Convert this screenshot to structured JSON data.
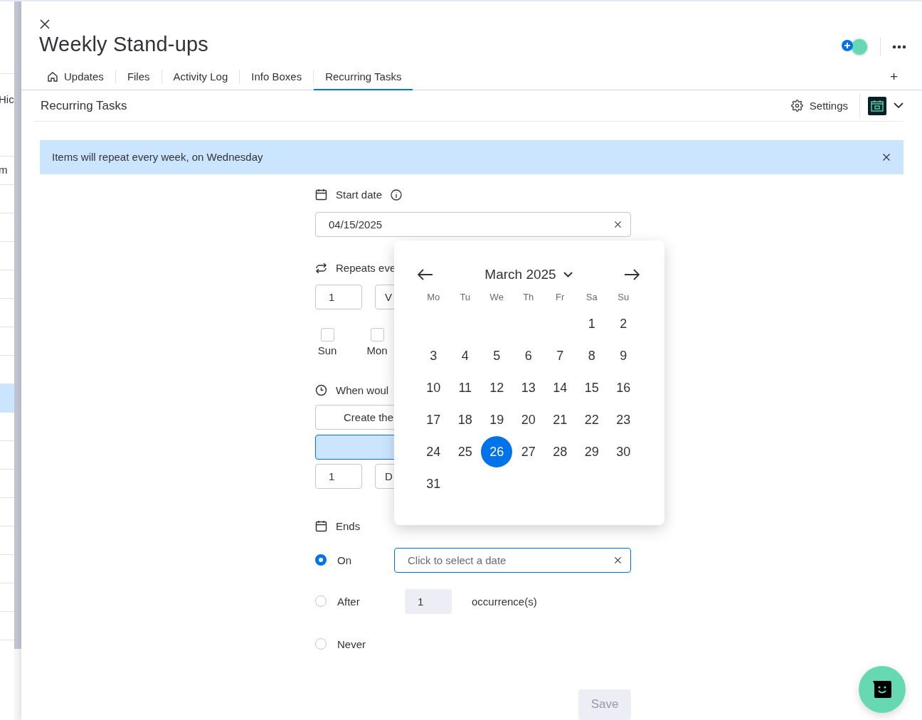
{
  "board_rows": [
    {
      "label": "Hic",
      "selected": false
    },
    {
      "label": "m",
      "selected": false
    },
    {
      "selected": false
    },
    {
      "selected": false
    },
    {
      "selected": false
    },
    {
      "selected": false
    },
    {
      "selected": false
    },
    {
      "selected": false
    },
    {
      "selected": false
    },
    {
      "selected": true
    },
    {
      "selected": false
    },
    {
      "selected": false
    },
    {
      "selected": false
    },
    {
      "selected": false
    },
    {
      "selected": false
    },
    {
      "selected": false
    },
    {
      "selected": false
    },
    {
      "selected": false
    },
    {
      "selected": false
    }
  ],
  "panel": {
    "title": "Weekly Stand-ups",
    "add_tab": "+",
    "tabs": [
      {
        "label": "Updates",
        "selected": false
      },
      {
        "label": "Files",
        "selected": false
      },
      {
        "label": "Activity Log",
        "selected": false
      },
      {
        "label": "Info Boxes",
        "selected": false
      },
      {
        "label": "Recurring Tasks",
        "selected": true
      }
    ]
  },
  "section": {
    "title": "Recurring Tasks",
    "settings": "Settings"
  },
  "banner": {
    "text": "Items will repeat every week, on Wednesday"
  },
  "form": {
    "start_date": {
      "label": "Start date",
      "value": "04/15/2025"
    },
    "repeats": {
      "label": "Repeats eve",
      "count": "1",
      "unit": "V",
      "days": [
        {
          "label": "Sun",
          "checked": false
        },
        {
          "label": "Mon",
          "checked": false
        }
      ]
    },
    "when": {
      "label": "When woul",
      "option": "Create the",
      "count": "1",
      "unit": "D"
    },
    "ends": {
      "label": "Ends",
      "options": [
        {
          "kind": "date",
          "label": "On",
          "selected": true,
          "placeholder": "Click to select a date"
        },
        {
          "kind": "count",
          "label": "After",
          "selected": false,
          "value": "1",
          "suffix": "occurrence(s)"
        },
        {
          "kind": "none",
          "label": "Never",
          "selected": false
        }
      ]
    },
    "save": {
      "label": "Save",
      "disabled": true
    }
  },
  "calendar": {
    "month": "March 2025",
    "weekdays": [
      "Mo",
      "Tu",
      "We",
      "Th",
      "Fr",
      "Sa",
      "Su"
    ],
    "weeks": [
      [
        {
          "day": "1",
          "selected": false
        },
        {
          "day": "2",
          "selected": false
        }
      ],
      [
        {
          "day": "3",
          "selected": false
        },
        {
          "day": "4",
          "selected": false
        },
        {
          "day": "5",
          "selected": false
        },
        {
          "day": "6",
          "selected": false
        },
        {
          "day": "7",
          "selected": false
        },
        {
          "day": "8",
          "selected": false
        },
        {
          "day": "9",
          "selected": false
        }
      ],
      [
        {
          "day": "10",
          "selected": false
        },
        {
          "day": "11",
          "selected": false
        },
        {
          "day": "12",
          "selected": false
        },
        {
          "day": "13",
          "selected": false
        },
        {
          "day": "14",
          "selected": false
        },
        {
          "day": "15",
          "selected": false
        },
        {
          "day": "16",
          "selected": false
        }
      ],
      [
        {
          "day": "17",
          "selected": false
        },
        {
          "day": "18",
          "selected": false
        },
        {
          "day": "19",
          "selected": false
        },
        {
          "day": "20",
          "selected": false
        },
        {
          "day": "21",
          "selected": false
        },
        {
          "day": "22",
          "selected": false
        },
        {
          "day": "23",
          "selected": false
        }
      ],
      [
        {
          "day": "24",
          "selected": false
        },
        {
          "day": "25",
          "selected": false
        },
        {
          "day": "26",
          "selected": true
        },
        {
          "day": "27",
          "selected": false
        },
        {
          "day": "28",
          "selected": false
        },
        {
          "day": "29",
          "selected": false
        },
        {
          "day": "30",
          "selected": false
        }
      ],
      [
        {
          "day": "31",
          "selected": false
        }
      ]
    ]
  }
}
